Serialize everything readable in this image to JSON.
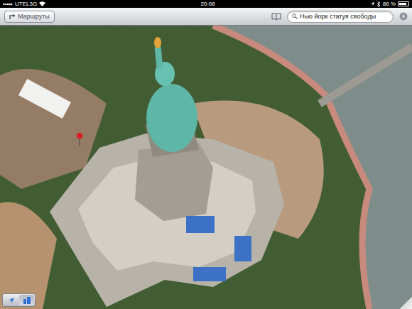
{
  "status_bar": {
    "carrier": "UTEL3G",
    "time": "20:08",
    "battery": "86 %",
    "battery_level": 0.86
  },
  "toolbar": {
    "directions_button": "Маршруты",
    "search": {
      "value": "Нью йорк статуя свободы"
    }
  },
  "controls": [
    {
      "name": "location",
      "selected": false
    },
    {
      "name": "flyover",
      "selected": true
    }
  ]
}
